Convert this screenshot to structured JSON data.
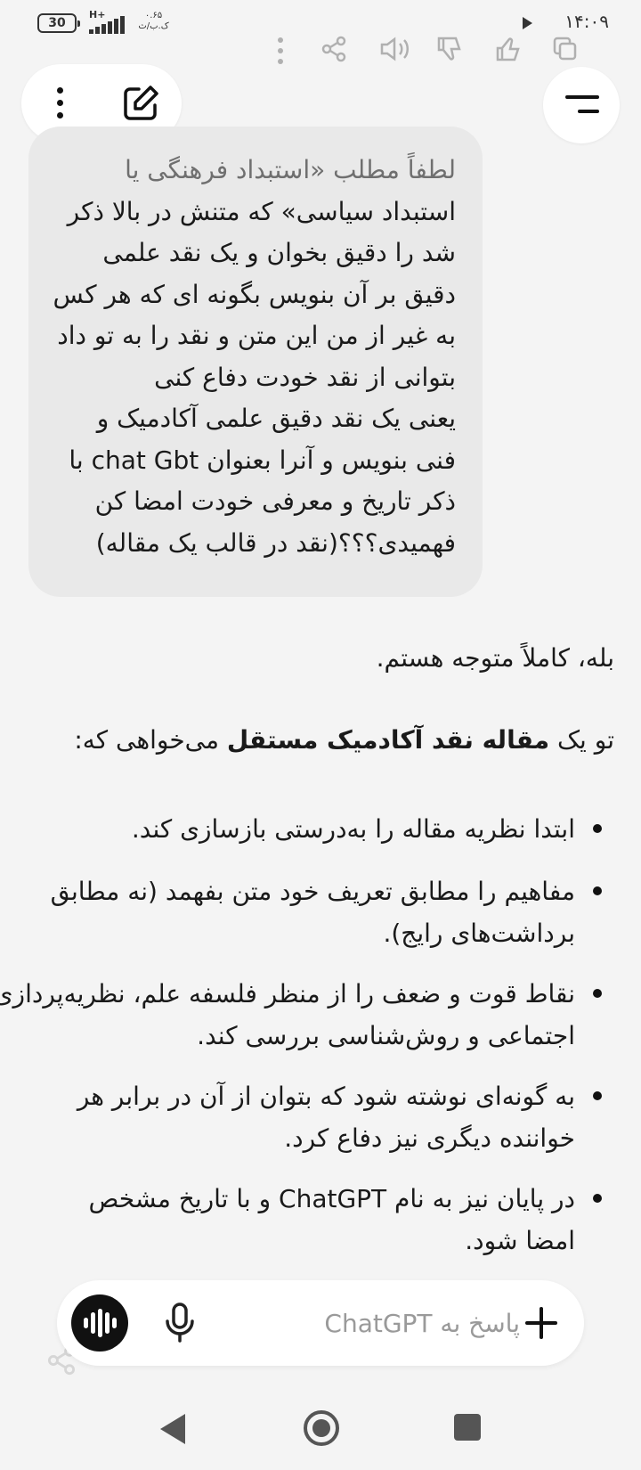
{
  "status_bar": {
    "battery": "30",
    "network_type": "H+",
    "net_speed_value": "۰.۶۵",
    "net_speed_unit": "ک.ب/ث",
    "time": "۱۴:۰۹"
  },
  "header": {
    "more_icon": "kebab-vertical-icon",
    "new_chat_icon": "edit-icon",
    "menu_icon": "menu-icon"
  },
  "user_message": {
    "lines": [
      "لطفاً مطلب «استبداد فرهنگی یا",
      "استبداد سیاسی» که متنش در بالا ذکر",
      "شد را دقیق بخوان و یک نقد علمی",
      "دقیق بر آن بنویس بگونه ای که هر کس",
      "به غیر از من این متن و نقد را به تو داد",
      "بتوانی از نقد خودت دفاع کنی",
      "یعنی یک نقد دقیق علمی آکادمیک و",
      "فنی بنویس و آنرا بعنوان chat Gbt با",
      "ذکر تاریخ و معرفی خودت  امضا کن",
      "فهمیدی؟؟؟(نقد در قالب یک مقاله)"
    ]
  },
  "assistant_message": {
    "intro": "بله، کاملاً متوجه هستم.",
    "request_before": "تو یک ",
    "request_bold": "مقاله نقد آکادمیک مستقل",
    "request_after": " می‌خواهی که:",
    "bullets": [
      [
        "ابتدا نظریه مقاله را به‌درستی بازسازی کند."
      ],
      [
        "مفاهیم را مطابق تعریف خود متن بفهمد (نه مطابق",
        "برداشت‌های رایج)."
      ],
      [
        "نقاط قوت و ضعف را از منظر فلسفه علم، نظریه‌پردازی",
        "اجتماعی و روش‌شناسی بررسی کند."
      ],
      [
        "به گونه‌ای نوشته شود که بتوان از آن در برابر هر",
        "خواننده دیگری نیز دفاع کرد."
      ],
      [
        "در پایان نیز به نام ChatGPT و با تاریخ مشخص",
        "امضا شود."
      ]
    ]
  },
  "composer": {
    "placeholder": "پاسخ به ChatGPT"
  },
  "colors": {
    "background": "#f4f4f4",
    "bubble": "#e9e9e9",
    "text": "#1a1a1a",
    "voice_button": "#111111"
  }
}
